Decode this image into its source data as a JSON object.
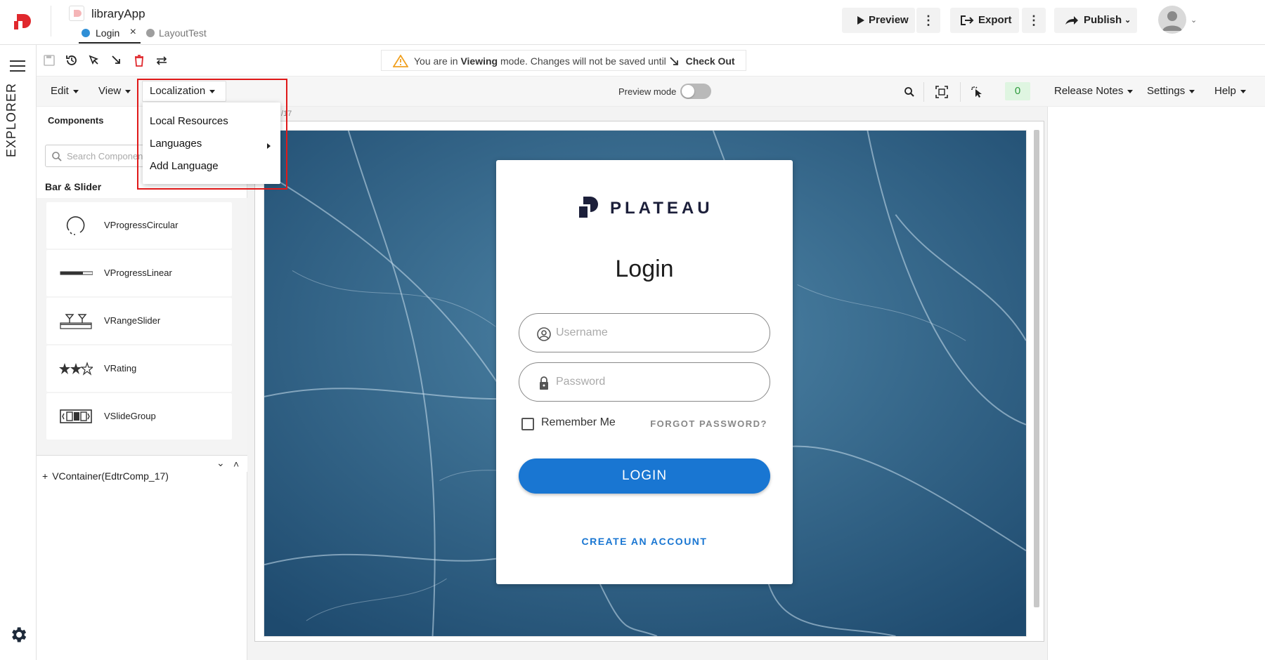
{
  "app": {
    "title": "libraryApp",
    "tabs": [
      {
        "label": "Login",
        "active": true,
        "dot_color": "#2f8fd6"
      },
      {
        "label": "LayoutTest",
        "active": false,
        "dot_color": "#9e9e9e"
      }
    ],
    "buttons": {
      "preview": "Preview",
      "export": "Export",
      "publish": "Publish"
    },
    "brand_color": "#e0282d"
  },
  "rail": {
    "explorer": "EXPLORER",
    "settings_icon": "gear-icon"
  },
  "banner": {
    "prefix": "You are in",
    "mode": "Viewing",
    "suffix": "mode. Changes will not be saved until",
    "action": "Check Out"
  },
  "menubar": {
    "edit": "Edit",
    "view": "View",
    "localization": "Localization",
    "preview_mode_label": "Preview mode",
    "preview_mode_on": false,
    "counter": "0",
    "release_notes": "Release Notes",
    "settings": "Settings",
    "help": "Help"
  },
  "localization_menu": {
    "items": [
      "Local Resources",
      "Languages",
      "Add Language"
    ]
  },
  "left_panel": {
    "tab": "Components",
    "search_placeholder": "Search Components",
    "category": "Bar & Slider",
    "components": [
      "VProgressCircular",
      "VProgressLinear",
      "VRangeSlider",
      "VRating",
      "VSlideGroup"
    ],
    "tree_item": "VContainer(EdtrComp_17)"
  },
  "canvas": {
    "crumb": "/17",
    "login": {
      "brand": "PLATEAU",
      "title": "Login",
      "username_placeholder": "Username",
      "password_placeholder": "Password",
      "remember_me": "Remember Me",
      "forgot": "FORGOT PASSWORD?",
      "login_button": "LOGIN",
      "create": "CREATE AN ACCOUNT",
      "button_color": "#1976d2"
    }
  }
}
